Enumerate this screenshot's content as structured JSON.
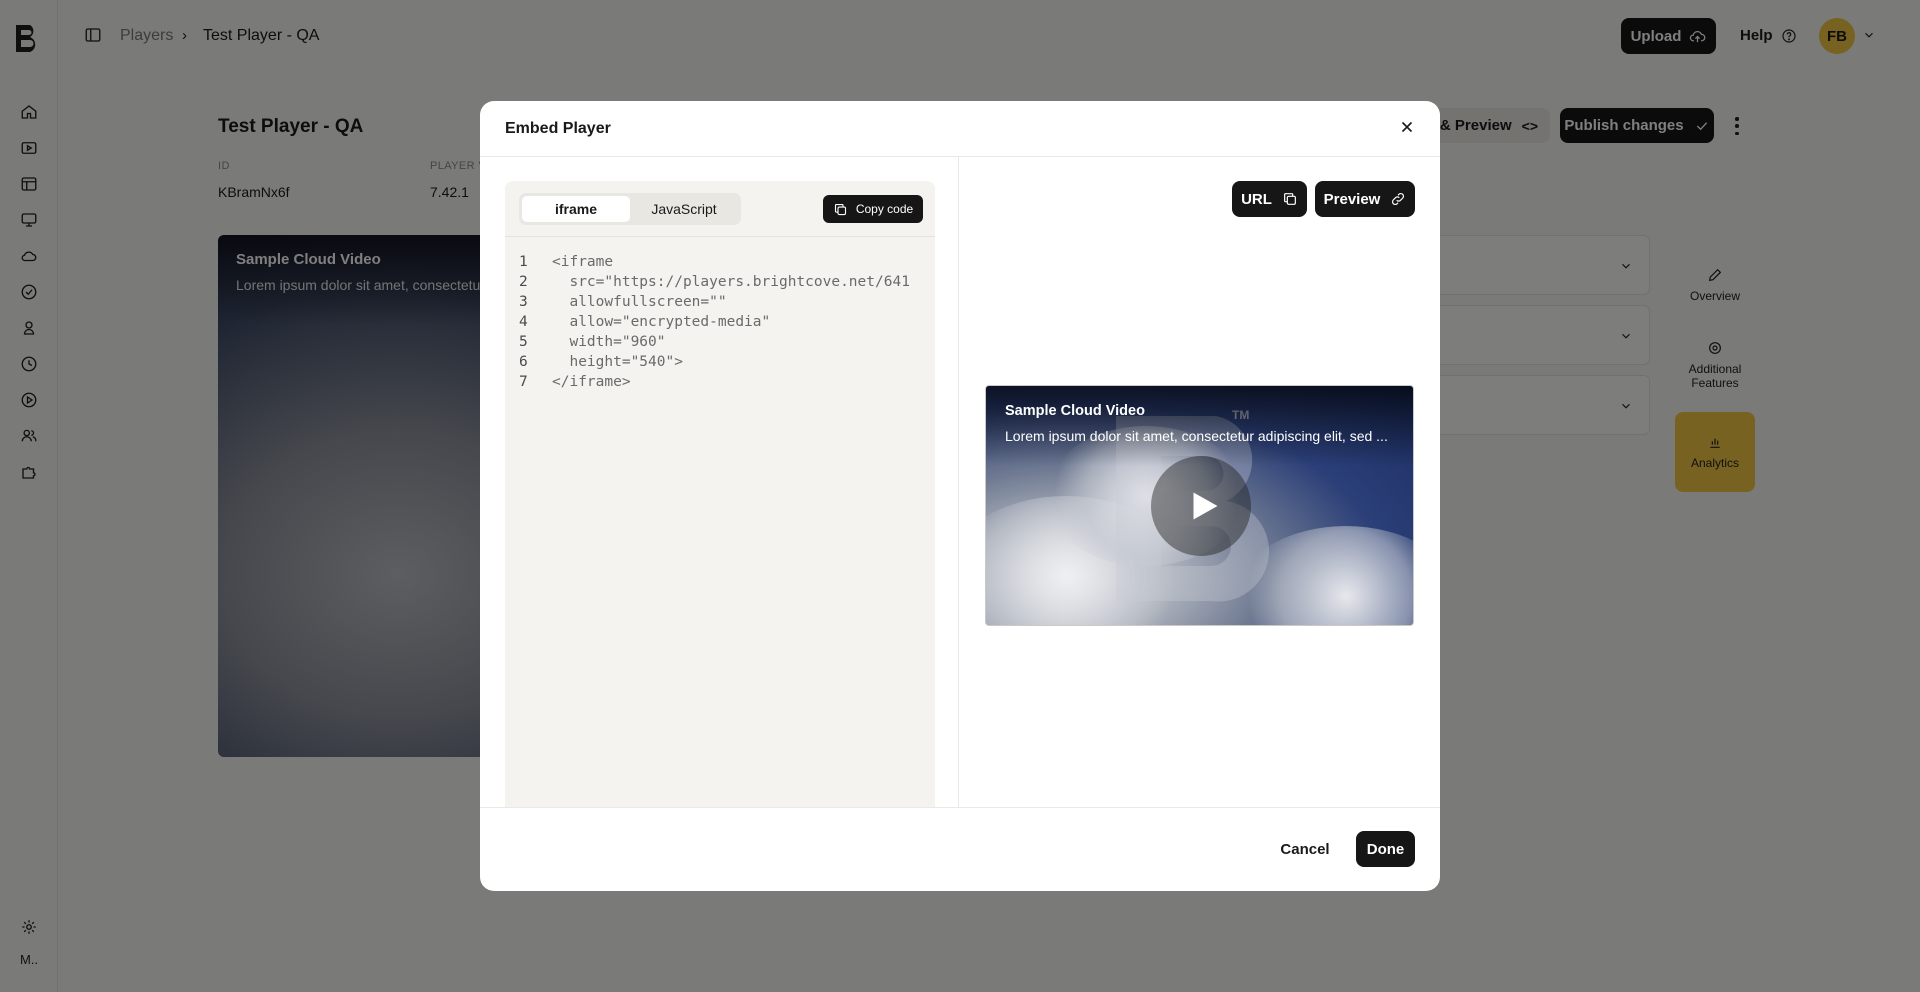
{
  "topbar": {
    "breadcrumb_link": "Players",
    "breadcrumb_sep": "›",
    "breadcrumb_current": "Test Player - QA",
    "upload_label": "Upload",
    "help_label": "Help",
    "avatar_initials": "FB"
  },
  "sidebar": {
    "items": [
      {
        "name": "home-icon"
      },
      {
        "name": "videos-icon"
      },
      {
        "name": "table-icon"
      },
      {
        "name": "monitor-icon"
      },
      {
        "name": "cloud-icon"
      },
      {
        "name": "shield-icon"
      },
      {
        "name": "plugin-icon"
      },
      {
        "name": "analytics-icon"
      },
      {
        "name": "player-icon"
      },
      {
        "name": "users-icon"
      },
      {
        "name": "puzzle-icon"
      }
    ],
    "settings_icon": "gear-icon",
    "bottom_label": "M.."
  },
  "page": {
    "title": "Test Player - QA",
    "id_label": "ID",
    "id_value": "KBramNx6f",
    "player_version_label": "PLAYER V",
    "player_version_value": "7.42.1",
    "embed_preview_label": "d & Preview",
    "publish_label": "Publish changes",
    "player_title": "Sample Cloud Video",
    "player_desc": "Lorem ipsum dolor sit amet, consectetu"
  },
  "side_tabs": {
    "overview": "Overview",
    "additional_features": "Additional Features",
    "analytics": "Analytics"
  },
  "modal": {
    "title": "Embed Player",
    "tabs": {
      "iframe": "iframe",
      "javascript": "JavaScript"
    },
    "active_tab": "iframe",
    "copy_code_label": "Copy code",
    "code_lines": [
      {
        "n": "1",
        "text": "<iframe"
      },
      {
        "n": "2",
        "text": "  src=\"https://players.brightcove.net/641"
      },
      {
        "n": "3",
        "text": "  allowfullscreen=\"\""
      },
      {
        "n": "4",
        "text": "  allow=\"encrypted-media\""
      },
      {
        "n": "5",
        "text": "  width=\"960\""
      },
      {
        "n": "6",
        "text": "  height=\"540\">"
      },
      {
        "n": "7",
        "text": "</iframe>"
      }
    ],
    "url_label": "URL",
    "preview_label": "Preview",
    "video": {
      "title": "Sample Cloud Video",
      "description": "Lorem ipsum dolor sit amet, consectetur adipiscing elit, sed ...",
      "tm": "TM"
    },
    "cancel_label": "Cancel",
    "done_label": "Done"
  },
  "colors": {
    "accent": "#f1c542",
    "primary_dark": "#161616",
    "background": "#f5f4f1"
  }
}
